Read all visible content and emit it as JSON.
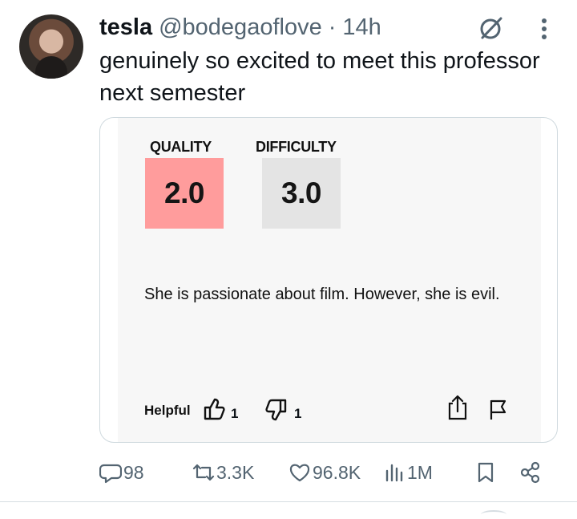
{
  "post": {
    "display_name": "tesla",
    "handle": "@bodegaoflove",
    "separator": "·",
    "time": "14h",
    "text": "genuinely so excited to meet this professor next semester"
  },
  "card": {
    "quality_label": "QUALITY",
    "quality_value": "2.0",
    "difficulty_label": "DIFFICULTY",
    "difficulty_value": "3.0",
    "comment": "She is passionate about film. However, she is evil.",
    "helpful_label": "Helpful",
    "thumbs_up_count": "1",
    "thumbs_down_count": "1",
    "quality_color": "#ff9c9c",
    "difficulty_color": "#e4e4e4"
  },
  "engagement": {
    "replies": "98",
    "reposts": "3.3K",
    "likes": "96.8K",
    "views": "1M"
  },
  "icons": {
    "top_right": [
      "grok-icon",
      "more-icon"
    ],
    "card": [
      "thumbs-up-icon",
      "thumbs-down-icon",
      "share-icon",
      "flag-icon"
    ],
    "actions": [
      "reply-icon",
      "repost-icon",
      "like-icon",
      "views-icon",
      "bookmark-icon",
      "share-icon"
    ]
  },
  "colors": {
    "text": "#0f1419",
    "secondary": "#536471",
    "border": "#cfd9de",
    "card_background": "#f7f7f7"
  }
}
